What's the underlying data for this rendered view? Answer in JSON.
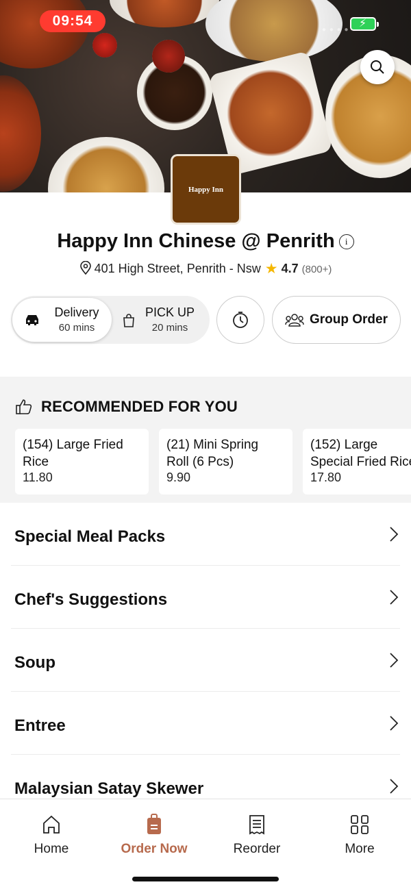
{
  "status_bar": {
    "time": "09:54",
    "battery_icon": "battery-charging-icon",
    "colors": {
      "time_pill": "#ff3b30",
      "battery": "#2ed158"
    }
  },
  "header": {
    "search_icon": "search-icon"
  },
  "restaurant": {
    "logo_text": "Happy Inn",
    "name": "Happy Inn Chinese @ Penrith",
    "address": "401 High Street, Penrith - Nsw",
    "rating": "4.7",
    "reviews": "(800+)"
  },
  "order_mode": {
    "delivery": {
      "label": "Delivery",
      "time": "60 mins"
    },
    "pickup": {
      "label": "PICK UP",
      "time": "20 mins"
    },
    "group_order": "Group Order"
  },
  "recommended": {
    "heading": "RECOMMENDED FOR YOU",
    "items": [
      {
        "name": "(154) Large Fried\nRice",
        "price": "11.80"
      },
      {
        "name": "(21) Mini Spring\nRoll (6 Pcs)",
        "price": "9.90"
      },
      {
        "name": "(152) Large\nSpecial Fried Rice",
        "price": "17.80"
      }
    ]
  },
  "categories": [
    {
      "label": "Special Meal Packs"
    },
    {
      "label": "Chef's Suggestions"
    },
    {
      "label": "Soup"
    },
    {
      "label": "Entree"
    },
    {
      "label": "Malaysian Satay Skewer"
    }
  ],
  "bottom_nav": {
    "accent": "#b76a4d",
    "tabs": [
      {
        "label": "Home",
        "icon": "home-icon"
      },
      {
        "label": "Order Now",
        "icon": "order-bag-icon"
      },
      {
        "label": "Reorder",
        "icon": "receipt-icon"
      },
      {
        "label": "More",
        "icon": "grid-icon"
      }
    ]
  }
}
